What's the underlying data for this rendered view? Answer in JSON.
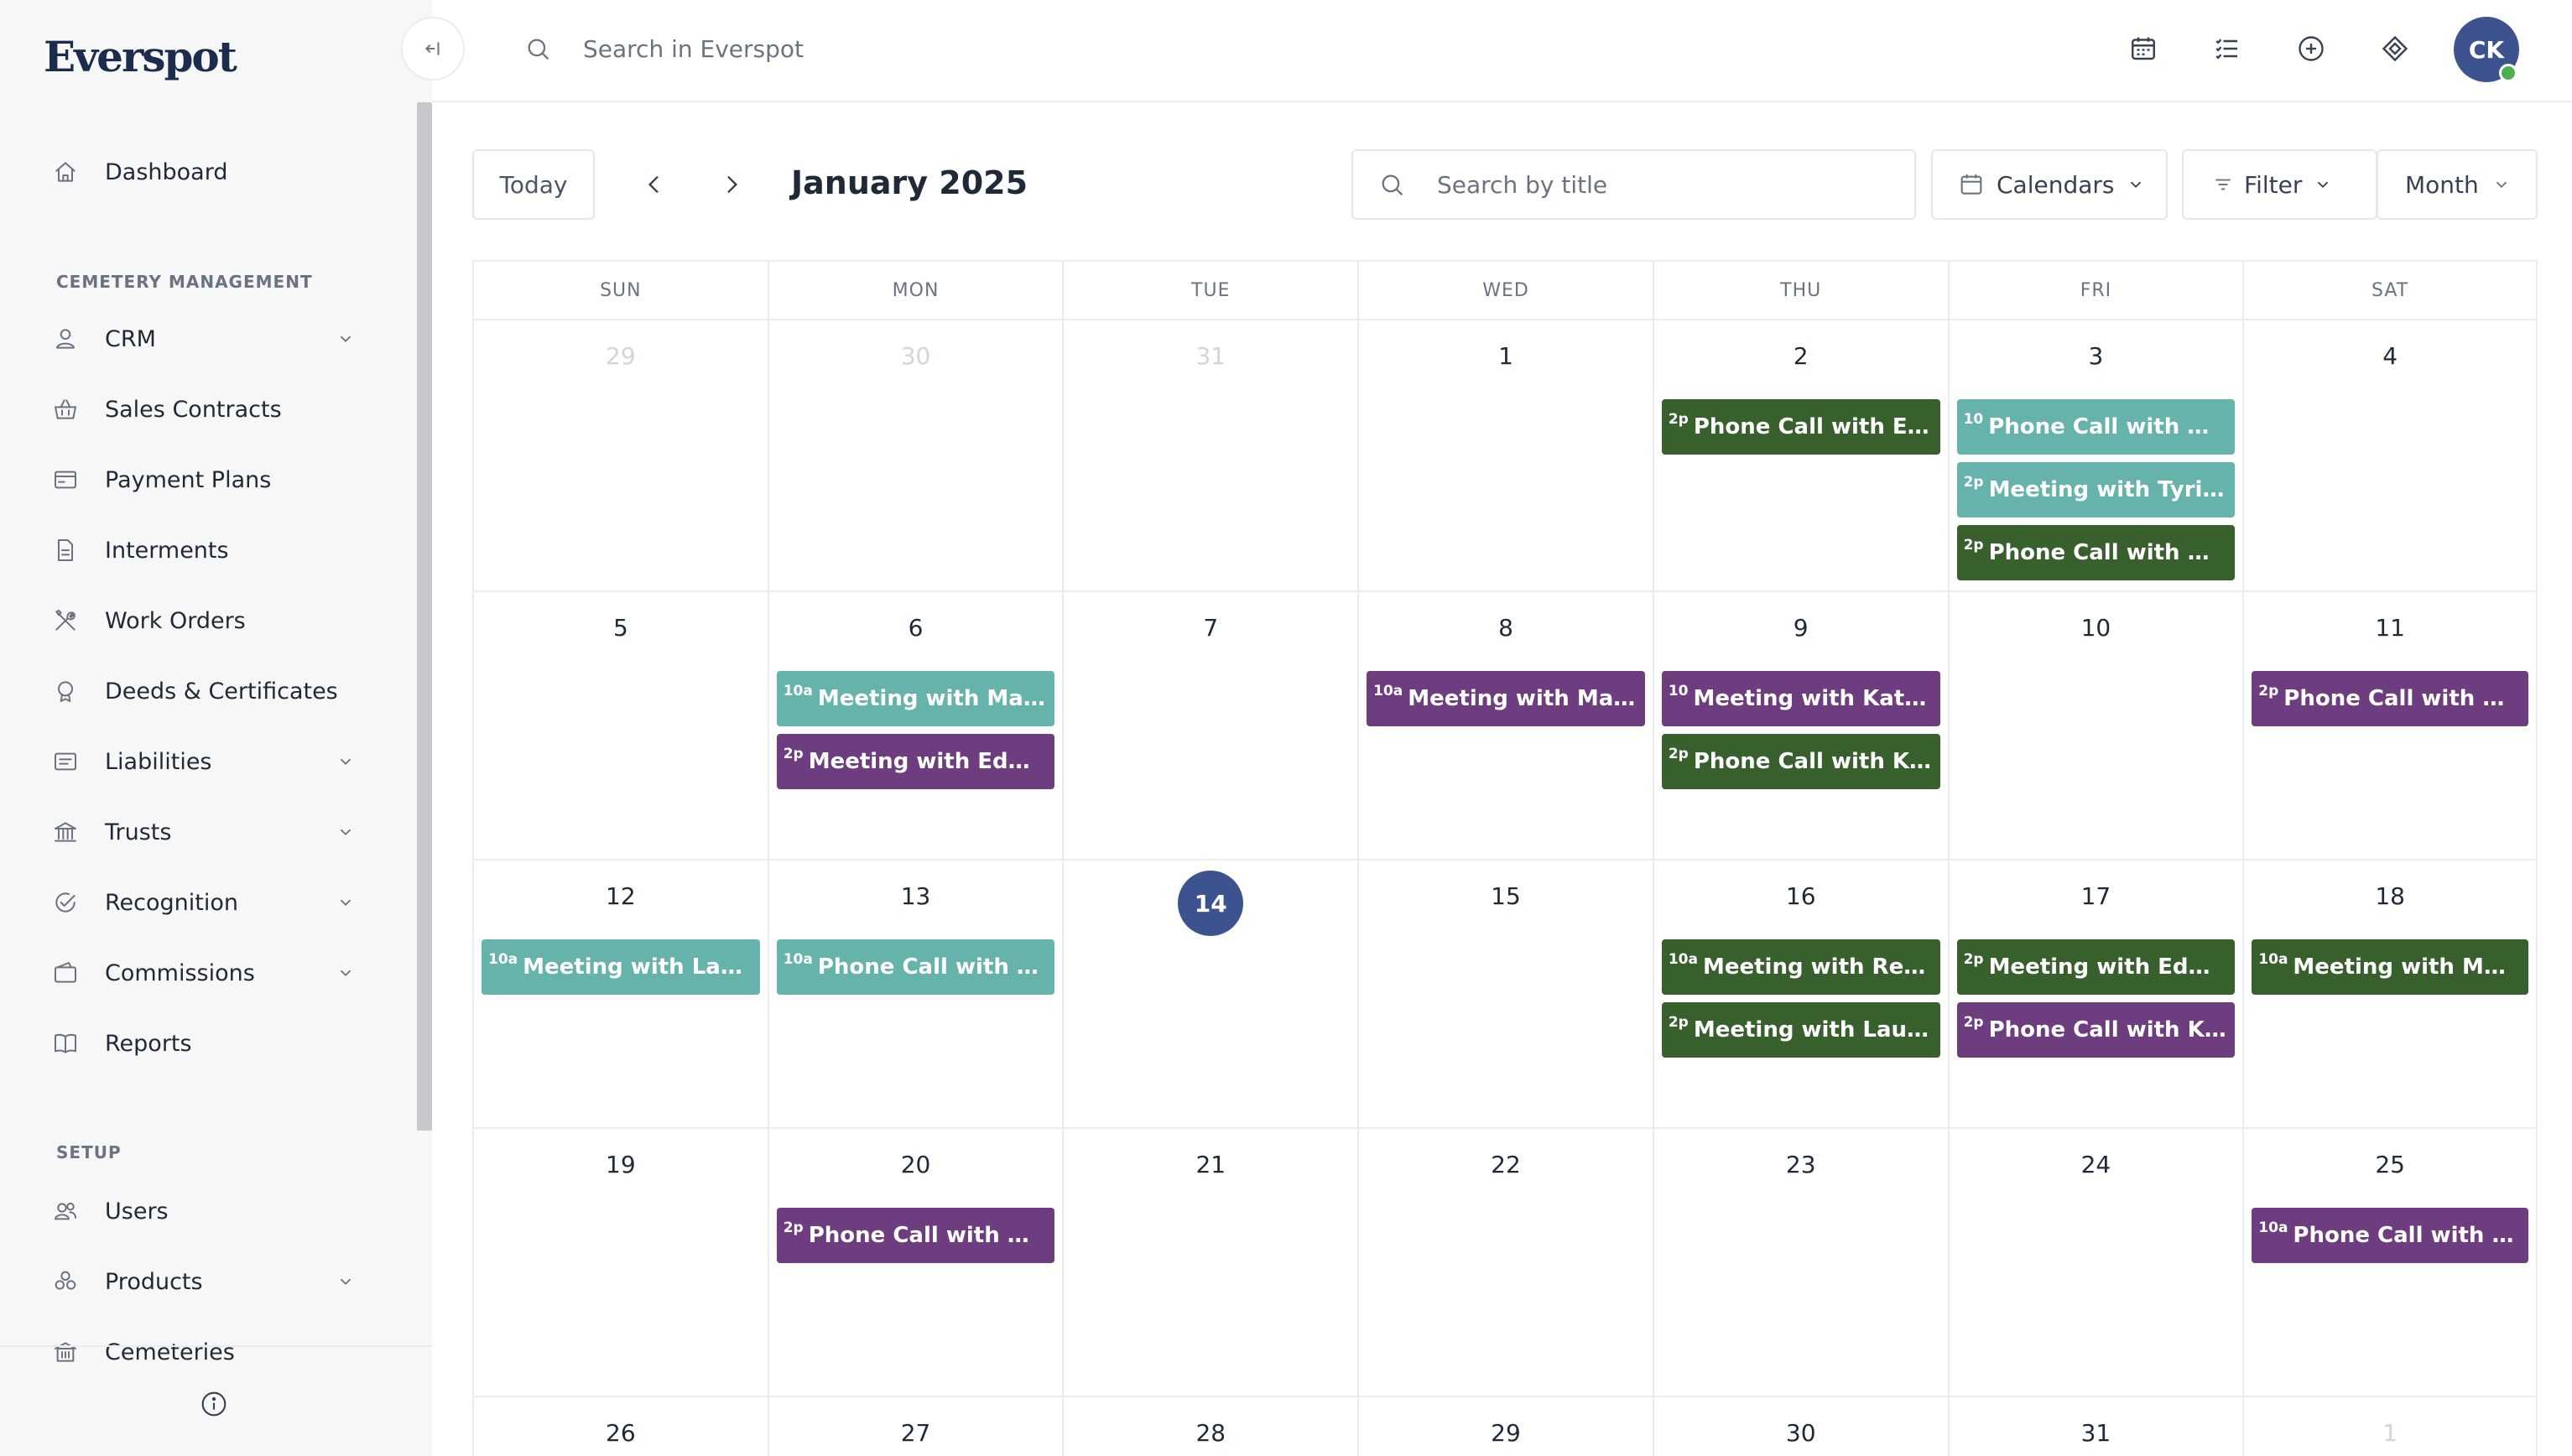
{
  "app": {
    "name": "Everspot"
  },
  "sidebar": {
    "collapse_icon": "collapse-left-icon",
    "sections": [
      {
        "label": "CEMETERY MANAGEMENT"
      },
      {
        "label": "SETUP"
      }
    ],
    "items": [
      {
        "label": "Dashboard",
        "icon": "home-icon",
        "expandable": false
      },
      {
        "label": "CRM",
        "icon": "user-icon",
        "expandable": true
      },
      {
        "label": "Sales Contracts",
        "icon": "basket-icon",
        "expandable": false
      },
      {
        "label": "Payment Plans",
        "icon": "payment-icon",
        "expandable": false
      },
      {
        "label": "Interments",
        "icon": "document-icon",
        "expandable": false
      },
      {
        "label": "Work Orders",
        "icon": "tools-icon",
        "expandable": false
      },
      {
        "label": "Deeds & Certificates",
        "icon": "certificate-icon",
        "expandable": false
      },
      {
        "label": "Liabilities",
        "icon": "ledger-icon",
        "expandable": true
      },
      {
        "label": "Trusts",
        "icon": "bank-icon",
        "expandable": true
      },
      {
        "label": "Recognition",
        "icon": "check-circle-icon",
        "expandable": true
      },
      {
        "label": "Commissions",
        "icon": "wallet-icon",
        "expandable": true
      },
      {
        "label": "Reports",
        "icon": "book-icon",
        "expandable": false
      },
      {
        "label": "Users",
        "icon": "users-icon",
        "expandable": false
      },
      {
        "label": "Products",
        "icon": "products-icon",
        "expandable": true
      },
      {
        "label": "Cemeteries",
        "icon": "building-icon",
        "expandable": false
      }
    ],
    "footer_icon": "info-icon"
  },
  "topbar": {
    "search_placeholder": "Search in Everspot",
    "icons": [
      "calendar-icon",
      "list-icon",
      "add-circle-icon",
      "apps-icon"
    ],
    "avatar_initials": "CK",
    "avatar_status_color": "#4caf50"
  },
  "toolbar": {
    "today_label": "Today",
    "month_title": "January 2025",
    "title_search_placeholder": "Search by title",
    "calendars_label": "Calendars",
    "filter_label": "Filter",
    "view_label": "Month"
  },
  "calendar": {
    "weekdays": [
      "SUN",
      "MON",
      "TUE",
      "WED",
      "THU",
      "FRI",
      "SAT"
    ],
    "today": 14,
    "colors": {
      "teal": "#65b3ab",
      "green": "#38602c",
      "purple": "#6d3d80"
    },
    "weeks": [
      [
        {
          "day": "29",
          "muted": true,
          "events": []
        },
        {
          "day": "30",
          "muted": true,
          "events": []
        },
        {
          "day": "31",
          "muted": true,
          "events": []
        },
        {
          "day": "1",
          "events": []
        },
        {
          "day": "2",
          "events": [
            {
              "time": "2p",
              "title": "Phone Call with Edwi...",
              "color": "green"
            }
          ]
        },
        {
          "day": "3",
          "events": [
            {
              "time": "10",
              "title": "Phone Call with Mich...",
              "color": "teal"
            },
            {
              "time": "2p",
              "title": "Meeting with Tyrique ...",
              "color": "teal"
            },
            {
              "time": "2p",
              "title": "Phone Call with Mart...",
              "color": "green"
            }
          ]
        },
        {
          "day": "4",
          "events": []
        }
      ],
      [
        {
          "day": "5",
          "events": []
        },
        {
          "day": "6",
          "events": [
            {
              "time": "10a",
              "title": "Meeting with Maci C...",
              "color": "teal"
            },
            {
              "time": "2p",
              "title": "Meeting with Edwina ...",
              "color": "purple"
            }
          ]
        },
        {
          "day": "7",
          "events": []
        },
        {
          "day": "8",
          "events": [
            {
              "time": "10a",
              "title": "Meeting with Marta ...",
              "color": "purple"
            }
          ]
        },
        {
          "day": "9",
          "events": [
            {
              "time": "10",
              "title": "Meeting with Kathry...",
              "color": "purple"
            },
            {
              "time": "2p",
              "title": "Phone Call with Kathr...",
              "color": "green"
            }
          ]
        },
        {
          "day": "10",
          "events": []
        },
        {
          "day": "11",
          "events": [
            {
              "time": "2p",
              "title": "Phone Call with Maci ...",
              "color": "purple"
            }
          ]
        }
      ],
      [
        {
          "day": "12",
          "events": [
            {
              "time": "10a",
              "title": "Meeting with Laurine...",
              "color": "teal"
            }
          ]
        },
        {
          "day": "13",
          "events": [
            {
              "time": "10a",
              "title": "Phone Call with Norb...",
              "color": "teal"
            }
          ]
        },
        {
          "day": "14",
          "today": true,
          "events": []
        },
        {
          "day": "15",
          "events": []
        },
        {
          "day": "16",
          "events": [
            {
              "time": "10a",
              "title": "Meeting with Rene O...",
              "color": "green"
            },
            {
              "time": "2p",
              "title": "Meeting with Laurine...",
              "color": "green"
            }
          ]
        },
        {
          "day": "17",
          "events": [
            {
              "time": "2p",
              "title": "Meeting with Edwina ...",
              "color": "green"
            },
            {
              "time": "2p",
              "title": "Phone Call with Kathr...",
              "color": "purple"
            }
          ]
        },
        {
          "day": "18",
          "events": [
            {
              "time": "10a",
              "title": "Meeting with Maci C...",
              "color": "green"
            }
          ]
        }
      ],
      [
        {
          "day": "19",
          "events": []
        },
        {
          "day": "20",
          "events": [
            {
              "time": "2p",
              "title": "Phone Call with Norb...",
              "color": "purple"
            }
          ]
        },
        {
          "day": "21",
          "events": []
        },
        {
          "day": "22",
          "events": []
        },
        {
          "day": "23",
          "events": []
        },
        {
          "day": "24",
          "events": []
        },
        {
          "day": "25",
          "events": [
            {
              "time": "10a",
              "title": "Phone Call with Edwi...",
              "color": "purple"
            }
          ]
        }
      ],
      [
        {
          "day": "26",
          "events": []
        },
        {
          "day": "27",
          "events": []
        },
        {
          "day": "28",
          "events": []
        },
        {
          "day": "29",
          "events": []
        },
        {
          "day": "30",
          "events": []
        },
        {
          "day": "31",
          "events": []
        },
        {
          "day": "1",
          "muted": true,
          "events": []
        }
      ]
    ]
  }
}
